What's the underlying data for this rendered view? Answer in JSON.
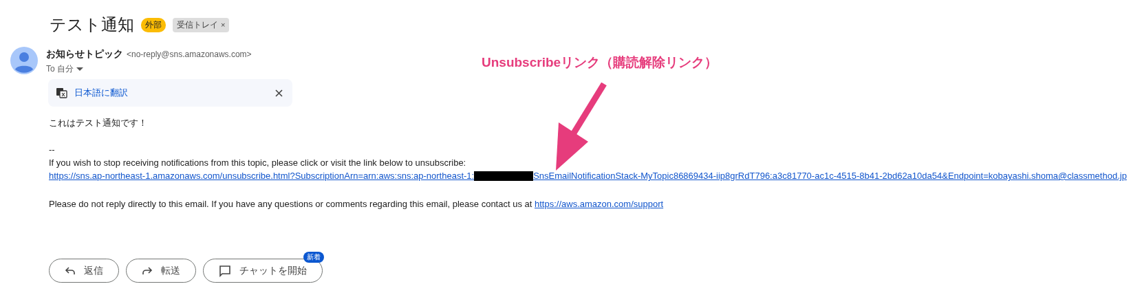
{
  "subject": "テスト通知",
  "labels": [
    {
      "text": "外部",
      "kind": "external"
    },
    {
      "text": "受信トレイ",
      "kind": "folder",
      "remove_icon": "×"
    }
  ],
  "sender": {
    "name": "お知らせトピック",
    "address": "<no-reply@sns.amazonaws.com>",
    "recipient": "To 自分"
  },
  "translate": {
    "label": "日本語に翻訳"
  },
  "body": {
    "greeting": "これはテスト通知です！",
    "separator": "--",
    "unsubscribe_text": "If you wish to stop receiving notifications from this topic, please click or visit the link below to unsubscribe:",
    "unsubscribe_link_start": "https://sns.ap-northeast-1.amazonaws.com/unsubscribe.html?SubscriptionArn=arn:aws:sns:ap-northeast-1:",
    "unsubscribe_link_end": "SnsEmailNotificationStack-MyTopic86869434-iip8grRdT796:a3c81770-ac1c-4515-8b41-2bd62a10da54&Endpoint=kobayashi.shoma@classmethod.jp",
    "contact_text": "Please do not reply directly to this email. If you have any questions or comments regarding this email, please contact us at",
    "contact_link": "https://aws.amazon.com/support"
  },
  "actions": [
    {
      "label": "返信",
      "kind": "reply"
    },
    {
      "label": "転送",
      "kind": "forward"
    },
    {
      "label": "チャットを開始",
      "kind": "chat",
      "badge": "新着"
    }
  ],
  "annotation": {
    "text": "Unsubscribeリンク（購読解除リンク）",
    "color": "#e63c7c"
  }
}
